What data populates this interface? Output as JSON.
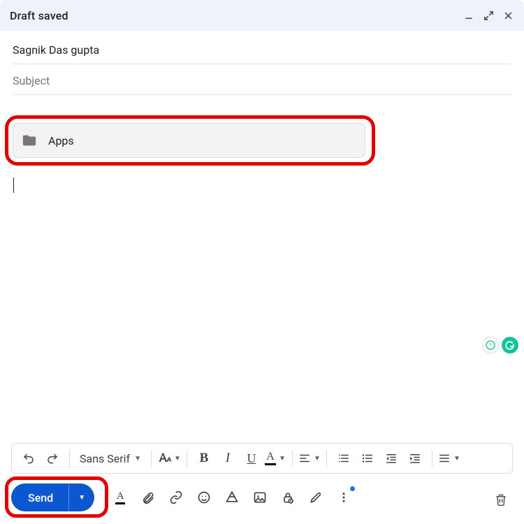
{
  "header": {
    "title": "Draft saved"
  },
  "fields": {
    "recipient": "Sagnik Das gupta",
    "subject_placeholder": "Subject",
    "subject_value": ""
  },
  "body": {
    "chip_label": "Apps"
  },
  "toolbar": {
    "font_label": "Sans Serif"
  },
  "actions": {
    "send_label": "Send"
  }
}
